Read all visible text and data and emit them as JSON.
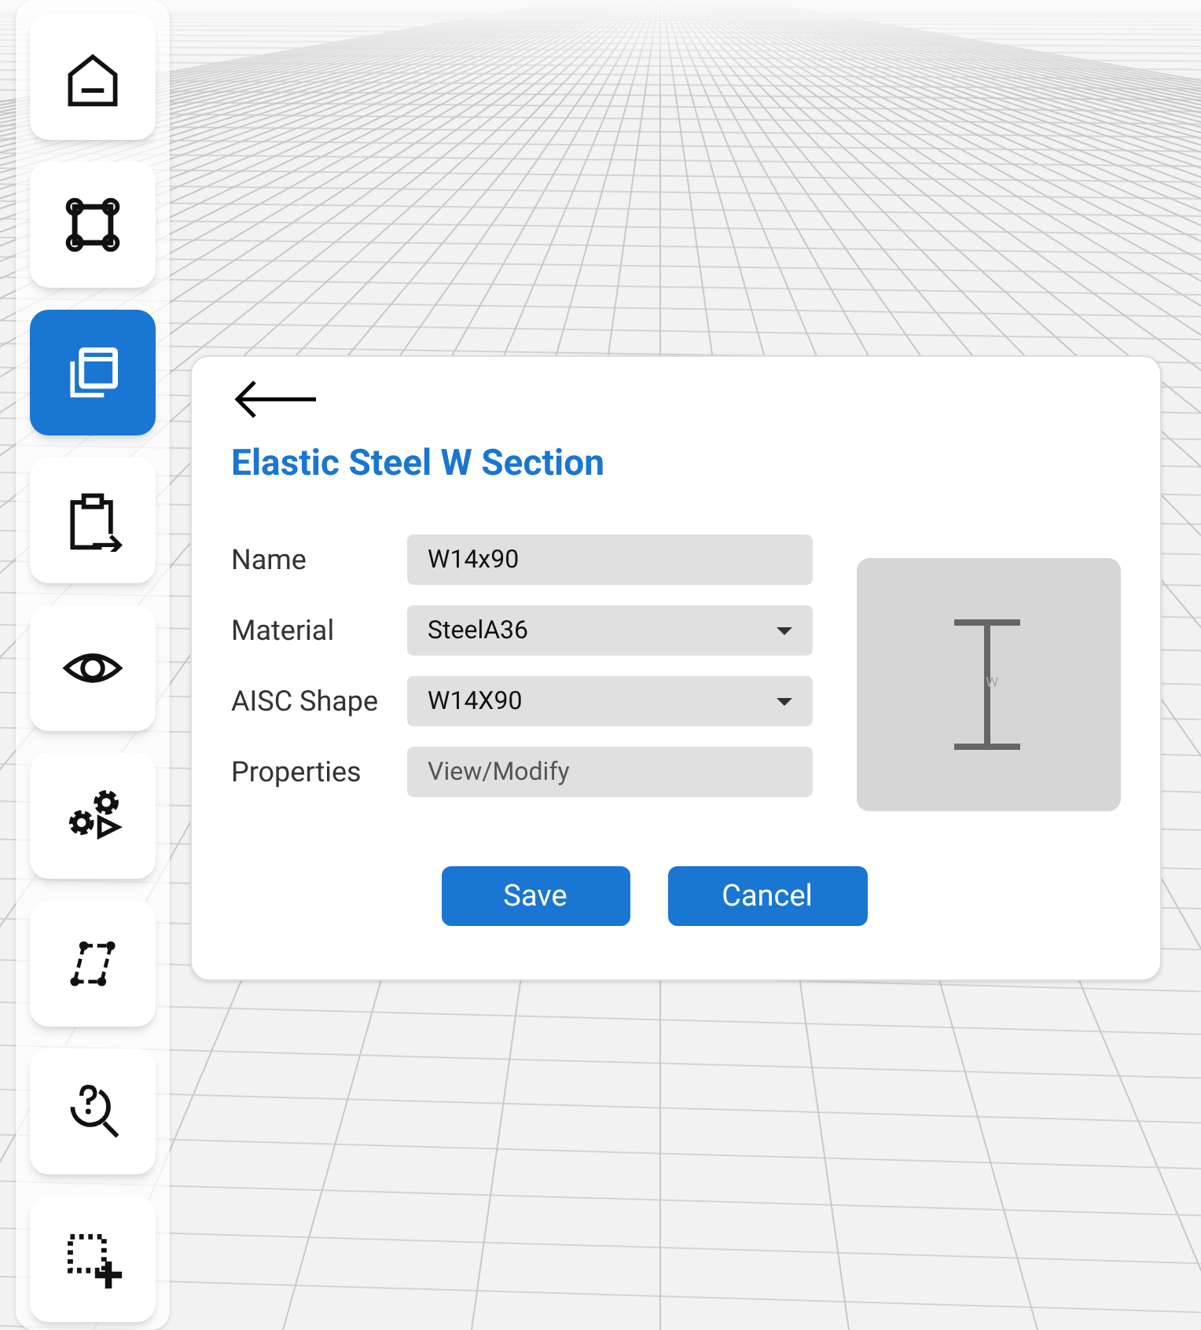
{
  "sidebar": {
    "items": [
      {
        "selected": false
      },
      {
        "selected": false
      },
      {
        "selected": true
      },
      {
        "selected": false
      },
      {
        "selected": false
      },
      {
        "selected": false
      },
      {
        "selected": false
      },
      {
        "selected": false
      },
      {
        "selected": false
      }
    ]
  },
  "dialog": {
    "title": "Elastic Steel W Section",
    "fields": [
      {
        "label": "Name",
        "kind": "text",
        "value": "W14x90"
      },
      {
        "label": "Material",
        "kind": "select",
        "value": "SteelA36"
      },
      {
        "label": "AISC Shape",
        "kind": "select",
        "value": "W14X90"
      },
      {
        "label": "Properties",
        "kind": "action",
        "value": "View/Modify"
      }
    ],
    "preview": {
      "label": "W"
    },
    "buttons": [
      "Save",
      "Cancel"
    ]
  }
}
